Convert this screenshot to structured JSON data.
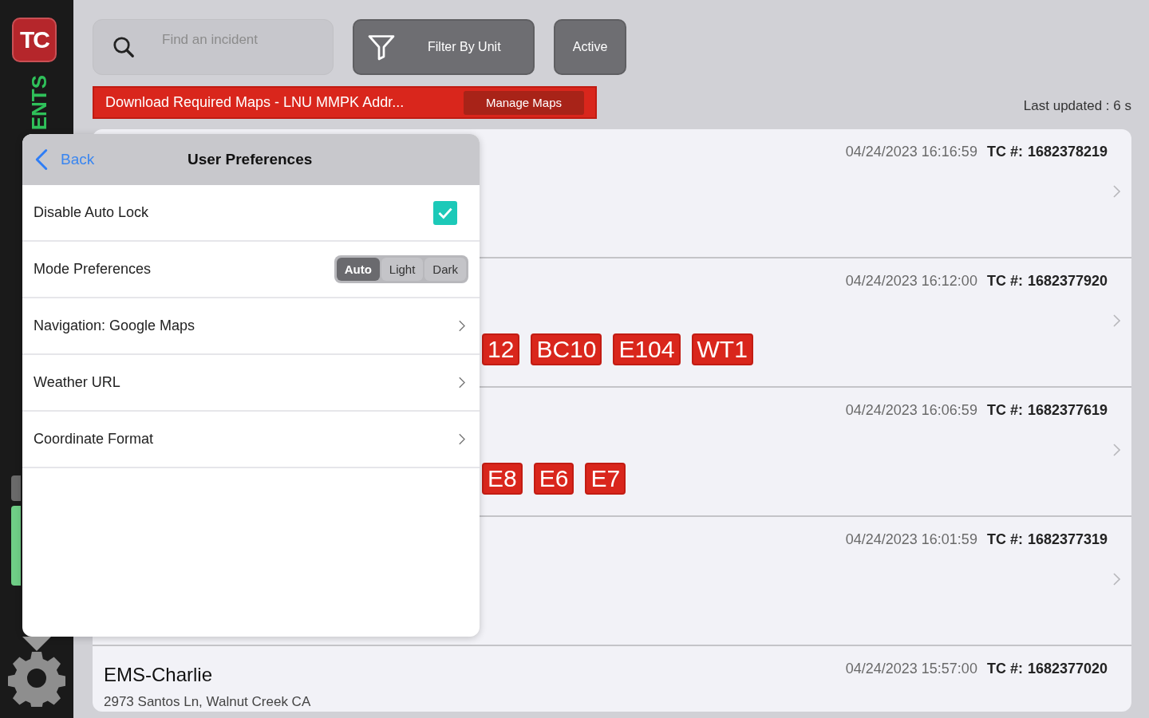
{
  "sidebar": {
    "logo": "TC",
    "section_label": "ENTS"
  },
  "search": {
    "placeholder": "Find an incident"
  },
  "filter_button": "Filter By Unit",
  "status_button": "Active",
  "banner": {
    "message": "Download Required Maps - LNU MMPK Addr...",
    "action": "Manage Maps"
  },
  "last_updated": "Last updated : 6 s",
  "incidents": [
    {
      "time": "04/24/2023 16:16:59",
      "tc_label": "TC #:",
      "tc_number": "1682378219"
    },
    {
      "time": "04/24/2023 16:12:00",
      "tc_label": "TC #:",
      "tc_number": "1682377920",
      "units": [
        "12",
        "BC10",
        "E104",
        "WT1"
      ]
    },
    {
      "time": "04/24/2023 16:06:59",
      "tc_label": "TC #:",
      "tc_number": "1682377619",
      "units": [
        "E8",
        "E6",
        "E7"
      ]
    },
    {
      "time": "04/24/2023 16:01:59",
      "tc_label": "TC #:",
      "tc_number": "1682377319"
    },
    {
      "title": "EMS-Charlie",
      "address": "2973 Santos Ln, Walnut Creek CA",
      "time": "04/24/2023 15:57:00",
      "tc_label": "TC #:",
      "tc_number": "1682377020"
    }
  ],
  "preferences": {
    "back": "Back",
    "title": "User Preferences",
    "rows": [
      {
        "kind": "checkbox",
        "label": "Disable Auto Lock",
        "checked": true
      },
      {
        "kind": "segmented",
        "label": "Mode Preferences",
        "options": [
          {
            "label": "Auto",
            "selected": true
          },
          {
            "label": "Light",
            "selected": false
          },
          {
            "label": "Dark",
            "selected": false
          }
        ]
      },
      {
        "kind": "link",
        "label": "Navigation: Google Maps"
      },
      {
        "kind": "link",
        "label": "Weather URL"
      },
      {
        "kind": "link",
        "label": "Coordinate Format"
      }
    ]
  }
}
